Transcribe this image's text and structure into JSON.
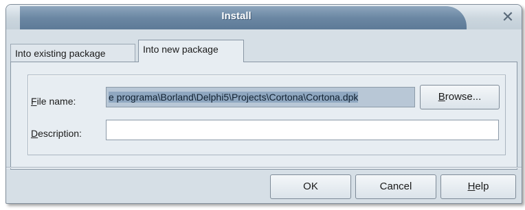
{
  "window": {
    "title": "Install",
    "close_glyph": "✕"
  },
  "tabs": [
    {
      "label": "Into existing package",
      "active": false
    },
    {
      "label": "Into new package",
      "active": true
    }
  ],
  "form": {
    "file_name_label_mnemonic": "F",
    "file_name_label_rest": "ile name:",
    "file_name_value": "e programa\\Borland\\Delphi5\\Projects\\Cortona\\Cortona.dpk",
    "browse_label_mnemonic": "B",
    "browse_label_rest": "rowse...",
    "description_label_mnemonic": "D",
    "description_label_rest": "escription:",
    "description_value": ""
  },
  "buttons": {
    "ok": "OK",
    "cancel": "Cancel",
    "help_mnemonic": "H",
    "help_rest": "elp"
  },
  "colors": {
    "title_bar": "#6b87a3",
    "selection": "#8fa7c0",
    "dialog_bg": "#d6dfe6"
  }
}
